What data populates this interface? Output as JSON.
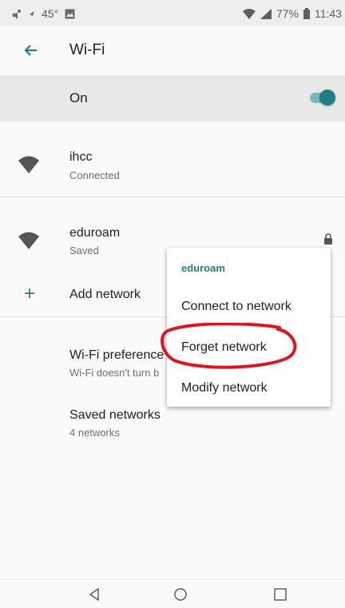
{
  "status_bar": {
    "temperature": "45°",
    "battery": "77%",
    "time": "11:43"
  },
  "header": {
    "title": "Wi-Fi"
  },
  "wifi_toggle": {
    "label": "On",
    "state": "on"
  },
  "networks": [
    {
      "name": "ihcc",
      "status": "Connected",
      "icon": "wifi-icon"
    },
    {
      "name": "eduroam",
      "status": "Saved",
      "icon": "wifi-icon",
      "secured": true
    }
  ],
  "add_network": {
    "label": "Add network",
    "icon": "plus-icon"
  },
  "preferences": {
    "title": "Wi-Fi preference",
    "subtitle": "Wi-Fi doesn't turn b"
  },
  "saved_networks": {
    "title": "Saved networks",
    "subtitle": "4 networks"
  },
  "context_menu": {
    "title": "eduroam",
    "items": [
      "Connect to network",
      "Forget network",
      "Modify network"
    ]
  },
  "colors": {
    "accent": "#1f7f83",
    "annotation": "#e0141c"
  },
  "nav_bar": {
    "icons": [
      "back-triangle-icon",
      "home-circle-icon",
      "recents-square-icon"
    ]
  }
}
